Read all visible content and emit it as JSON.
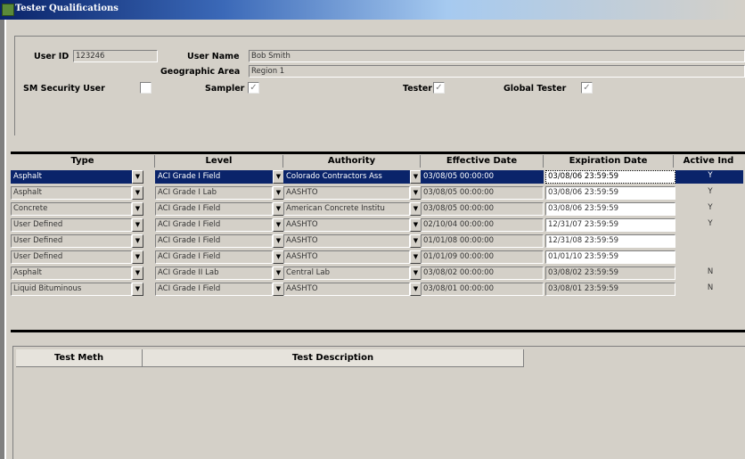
{
  "window": {
    "title": "Tester Qualifications"
  },
  "user": {
    "id_label": "User ID",
    "id_value": "123246",
    "name_label": "User Name",
    "name_value": "Bob Smith",
    "geo_label": "Geographic Area",
    "geo_value": "Region 1"
  },
  "flags": {
    "sm_security_label": "SM Security User",
    "sm_security_mark": "",
    "sampler_label": "Sampler",
    "sampler_mark": "✓",
    "tester_label": "Tester",
    "tester_mark": "✓",
    "global_tester_label": "Global Tester",
    "global_tester_mark": "✓"
  },
  "grid": {
    "headers": {
      "type": "Type",
      "level": "Level",
      "authority": "Authority",
      "effective": "Effective Date",
      "expiration": "Expiration Date",
      "active": "Active Ind"
    },
    "rows": [
      {
        "type": "Asphalt",
        "level": "ACI Grade I Field",
        "authority": "Colorado Contractors Ass",
        "effective": "03/08/05 00:00:00",
        "expiration": "03/08/06 23:59:59",
        "active": "Y"
      },
      {
        "type": "Asphalt",
        "level": "ACI Grade I Lab",
        "authority": "AASHTO",
        "effective": "03/08/05 00:00:00",
        "expiration": "03/08/06 23:59:59",
        "active": "Y"
      },
      {
        "type": "Concrete",
        "level": "ACI Grade I Field",
        "authority": "American Concrete Institu",
        "effective": "03/08/05 00:00:00",
        "expiration": "03/08/06 23:59:59",
        "active": "Y"
      },
      {
        "type": "User Defined",
        "level": "ACI Grade I Field",
        "authority": "AASHTO",
        "effective": "02/10/04 00:00:00",
        "expiration": "12/31/07 23:59:59",
        "active": "Y"
      },
      {
        "type": "User Defined",
        "level": "ACI Grade I Field",
        "authority": "AASHTO",
        "effective": "01/01/08 00:00:00",
        "expiration": "12/31/08 23:59:59",
        "active": ""
      },
      {
        "type": "User Defined",
        "level": "ACI Grade I Field",
        "authority": "AASHTO",
        "effective": "01/01/09 00:00:00",
        "expiration": "01/01/10 23:59:59",
        "active": ""
      },
      {
        "type": "Asphalt",
        "level": "ACI Grade II Lab",
        "authority": "Central Lab",
        "effective": "03/08/02 00:00:00",
        "expiration": "03/08/02 23:59:59",
        "active": "N"
      },
      {
        "type": "Liquid Bituminous",
        "level": "ACI Grade I Field",
        "authority": "AASHTO",
        "effective": "03/08/01 00:00:00",
        "expiration": "03/08/01 23:59:59",
        "active": "N"
      }
    ]
  },
  "tests": {
    "headers": {
      "meth": "Test Meth",
      "desc": "Test Description"
    }
  },
  "icons": {
    "dropdown": "chevron-down-icon",
    "checkbox": "check-icon",
    "window": "window-icon"
  }
}
